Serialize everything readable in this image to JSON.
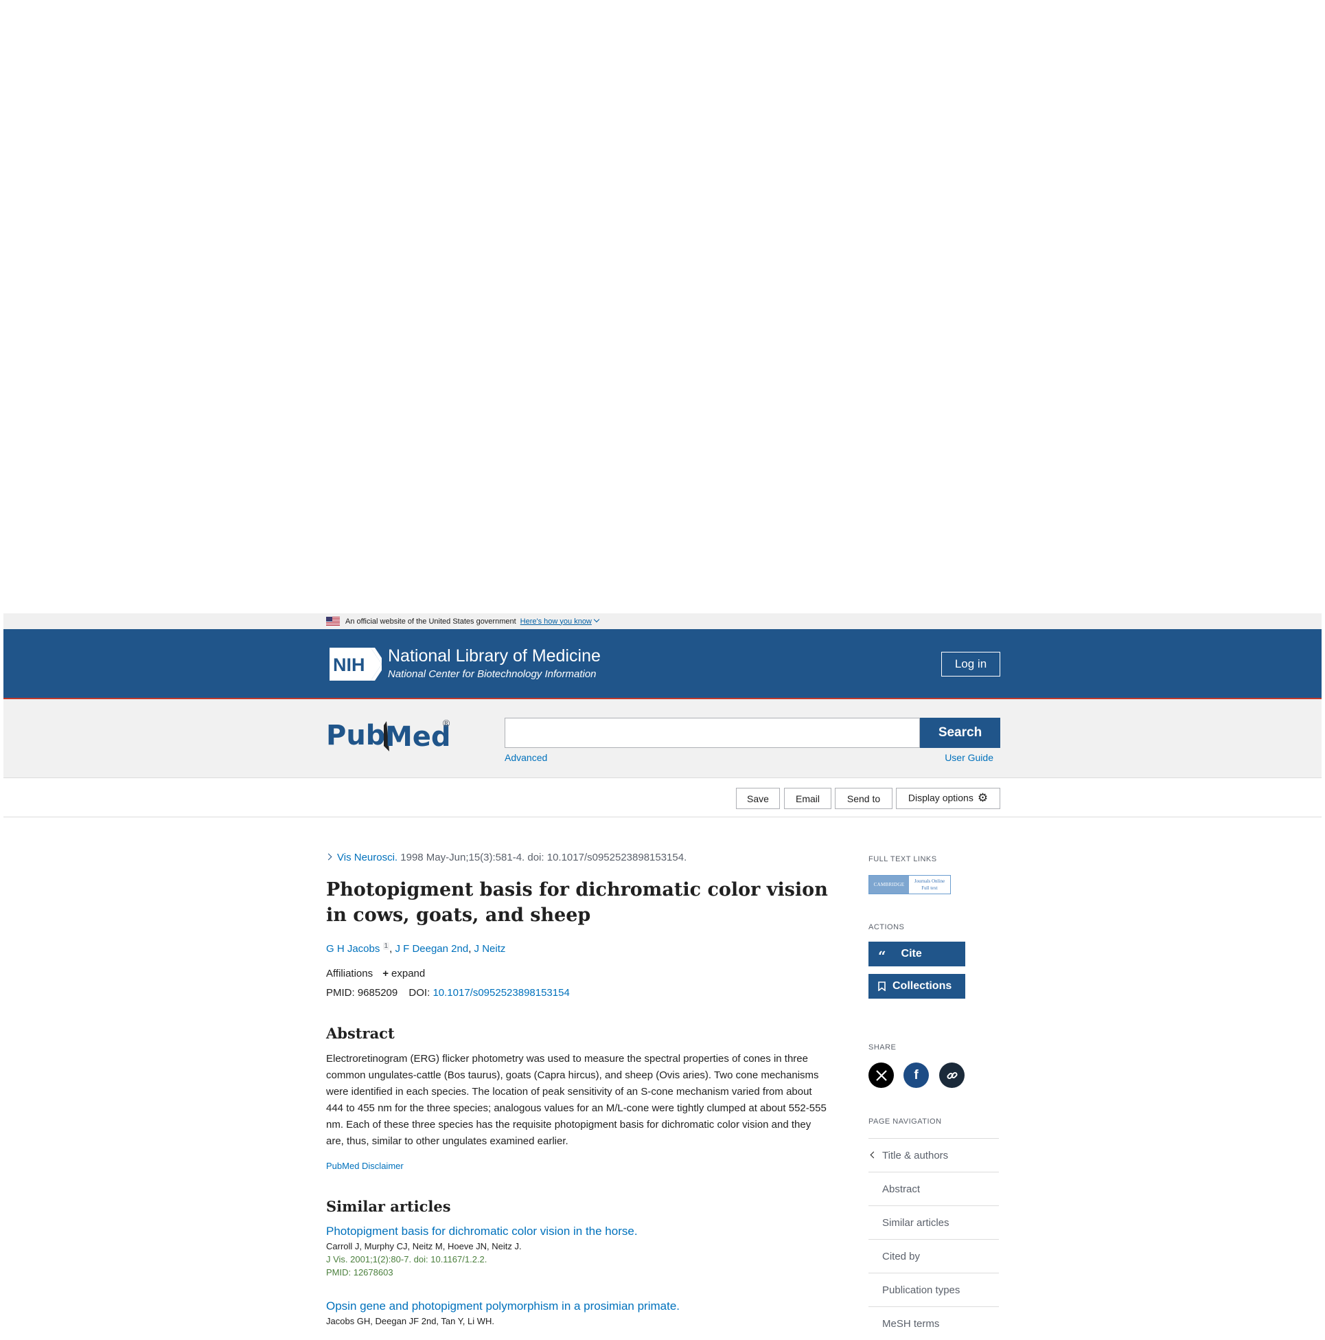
{
  "gov_banner": {
    "text": "An official website of the United States government",
    "link": "Here's how you know"
  },
  "nlm_header": {
    "logo": "NIH",
    "title": "National Library of Medicine",
    "subtitle": "National Center for Biotechnology Information",
    "login_label": "Log in"
  },
  "search": {
    "logo_text_left": "Pub",
    "logo_text_right": "Med",
    "logo_reg": "®",
    "value": "",
    "button_label": "Search",
    "advanced_label": "Advanced",
    "user_guide_label": "User Guide"
  },
  "toolbar": {
    "save_label": "Save",
    "email_label": "Email",
    "send_to_label": "Send to",
    "display_options_label": "Display options"
  },
  "article": {
    "journal": "Vis Neurosci.",
    "citation_rest": "1998 May-Jun;15(3):581-4. doi: 10.1017/s0952523898153154.",
    "title": "Photopigment basis for dichromatic color vision in cows, goats, and sheep",
    "authors": [
      {
        "name": "G H Jacobs",
        "sup": "1"
      },
      {
        "name": "J F Deegan 2nd"
      },
      {
        "name": "J Neitz"
      }
    ],
    "affiliations_label": "Affiliations",
    "expand_label": "expand",
    "pmid_label": "PMID:",
    "pmid_value": "9685209",
    "doi_label": "DOI:",
    "doi_value": "10.1017/s0952523898153154"
  },
  "abstract": {
    "heading": "Abstract",
    "text": "Electroretinogram (ERG) flicker photometry was used to measure the spectral properties of cones in three common ungulates-cattle (Bos taurus), goats (Capra hircus), and sheep (Ovis aries). Two cone mechanisms were identified in each species. The location of peak sensitivity of an S-cone mechanism varied from about 444 to 455 nm for the three species; analogous values for an M/L-cone were tightly clumped at about 552-555 nm. Each of these three species has the requisite photopigment basis for dichromatic color vision and they are, thus, similar to other ungulates examined earlier.",
    "disclaimer": "PubMed Disclaimer"
  },
  "similar": {
    "heading": "Similar articles",
    "items": [
      {
        "title": "Photopigment basis for dichromatic color vision in the horse.",
        "authors": "Carroll J, Murphy CJ, Neitz M, Hoeve JN, Neitz J.",
        "citation": "J Vis. 2001;1(2):80-7. doi: 10.1167/1.2.2.",
        "pmid": "PMID: 12678603"
      },
      {
        "title": "Opsin gene and photopigment polymorphism in a prosimian primate.",
        "authors": "Jacobs GH, Deegan JF 2nd, Tan Y, Li WH.",
        "citation": "",
        "pmid": ""
      }
    ]
  },
  "sidebar": {
    "full_text_links_label": "FULL TEXT LINKS",
    "ftl_left": "CAMBRIDGE",
    "ftl_right_1": "Journals Online",
    "ftl_right_2": "Full text",
    "actions_label": "ACTIONS",
    "cite_label": "Cite",
    "collections_label": "Collections",
    "share_label": "SHARE",
    "page_nav_label": "PAGE NAVIGATION",
    "nav_items": [
      "Title & authors",
      "Abstract",
      "Similar articles",
      "Cited by",
      "Publication types",
      "MeSH terms"
    ]
  },
  "colors": {
    "header_blue": "#20558a",
    "link_blue": "#0071bc",
    "citation_green": "#4a7f3c",
    "facebook_blue": "#1d4c85"
  }
}
